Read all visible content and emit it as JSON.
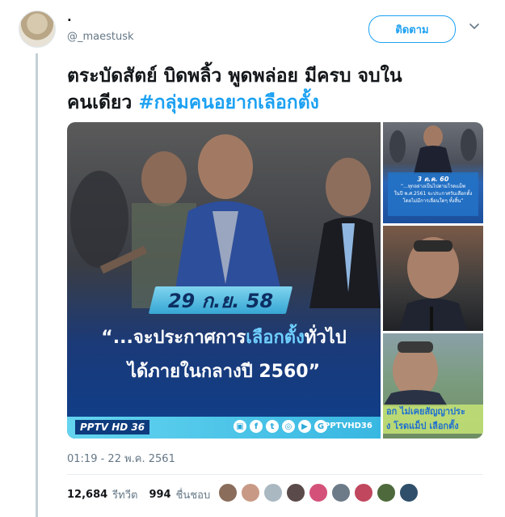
{
  "tweet": {
    "author_name": ".",
    "author_handle": "@_maestusk",
    "follow_label": "ติดตาม",
    "text_line1": "ตระบัดสัตย์ บิดพลิ้ว พูดพล่อย มีครบ จบใน",
    "text_line2_plain": "คนเดียว ",
    "hashtag": "#กลุ่มคนอยากเลือกตั้ง",
    "timestamp": "01:19 - 22 พ.ค. 2561",
    "retweets_count": "12,684",
    "retweets_label": "รีทวีต",
    "likes_count": "994",
    "likes_label": "ชื่นชอบ"
  },
  "media": {
    "main": {
      "date": "29 ก.ย. 58",
      "quote_pre": "“...จะประกาศการ",
      "quote_highlight": "เลือกตั้ง",
      "quote_post": "ทั่วไป",
      "quote_line2": "ได้ภายในกลางปี 2560”",
      "channel_logo": "PPTV HD 36",
      "channel_handle": "PPTVHD36"
    },
    "side1": {
      "date": "3 ต.ค. 60",
      "caption1": "“...ทุกอย่างเป็นไปตามโรดแม็พ",
      "caption2": "ในปี พ.ศ.2561 จะประกาศวันเลือกตั้ง",
      "caption3": "โดยไม่มีการเลื่อนใดๆ ทั้งสิ้น”"
    },
    "side3": {
      "line1": "อก ไม่เคยสัญญาประ",
      "line2": "ง โรดแม็ป เลือกตั้ง"
    }
  },
  "colors": {
    "accent": "#1da1f2",
    "muted": "#657786",
    "text": "#14171a"
  },
  "icons": {
    "caret": "chevron-down-icon"
  }
}
